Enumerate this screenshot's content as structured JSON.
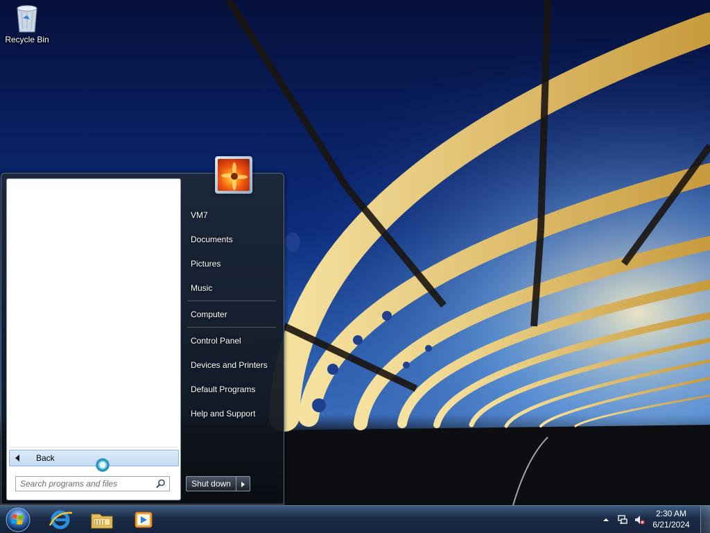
{
  "desktop": {
    "icons": [
      {
        "label": "Recycle Bin",
        "icon": "recycle-bin-icon"
      }
    ]
  },
  "start_menu": {
    "user_picture": "user-picture-flower",
    "right_items": [
      {
        "label": "VM7",
        "icon": "user-folder"
      },
      {
        "label": "Documents",
        "icon": "documents"
      },
      {
        "label": "Pictures",
        "icon": "pictures"
      },
      {
        "label": "Music",
        "icon": "music"
      },
      {
        "label": "Computer",
        "icon": "computer"
      },
      {
        "label": "Control Panel",
        "icon": "control-panel"
      },
      {
        "label": "Devices and Printers",
        "icon": "devices-printers"
      },
      {
        "label": "Default Programs",
        "icon": "default-programs"
      },
      {
        "label": "Help and Support",
        "icon": "help-support"
      }
    ],
    "back_label": "Back",
    "search": {
      "placeholder": "Search programs and files",
      "value": ""
    },
    "shutdown_label": "Shut down"
  },
  "taskbar": {
    "pinned": [
      {
        "name": "internet-explorer",
        "icon": "internet-explorer-icon"
      },
      {
        "name": "windows-explorer",
        "icon": "folder-library-icon"
      },
      {
        "name": "windows-media-player",
        "icon": "media-player-icon"
      }
    ],
    "clock": {
      "time": "2:30 AM",
      "date": "6/21/2024"
    }
  },
  "colors": {
    "taskbar_top": "#3d5a80",
    "taskbar_bottom": "#14233a",
    "start_menu_bg": "#141a24",
    "back_row": "#c3dbf3"
  }
}
